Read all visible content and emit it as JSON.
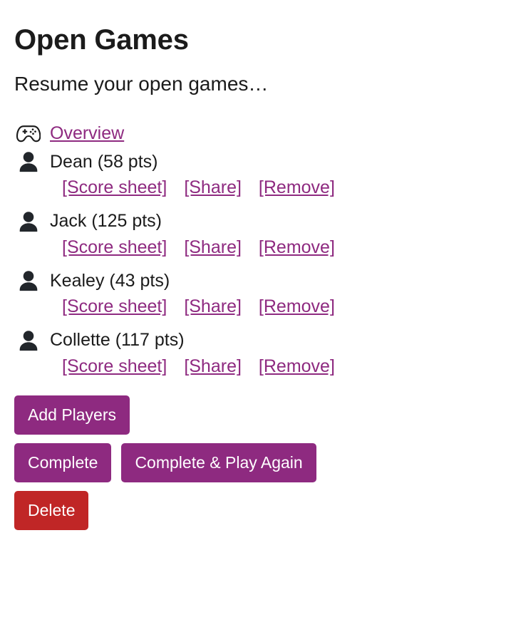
{
  "header": {
    "title": "Open Games",
    "subtitle": "Resume your open games…"
  },
  "colors": {
    "link": "#8e2a80",
    "button_primary": "#8e2a80",
    "button_danger": "#c02626",
    "text": "#1b1b1b",
    "background": "#ffffff"
  },
  "game": {
    "overview_icon": "gamepad-icon",
    "overview_label": "Overview",
    "player_icon": "person-icon",
    "actions": {
      "score_sheet": "[Score sheet]",
      "share": "[Share]",
      "remove": "[Remove]"
    },
    "players": [
      {
        "name": "Dean",
        "points": "58",
        "label": "Dean (58 pts)"
      },
      {
        "name": "Jack",
        "points": "125",
        "label": "Jack (125 pts)"
      },
      {
        "name": "Kealey",
        "points": "43",
        "label": "Kealey (43 pts)"
      },
      {
        "name": "Collette",
        "points": "117",
        "label": "Collette (117 pts)"
      }
    ]
  },
  "buttons": {
    "add_players": "Add Players",
    "complete": "Complete",
    "complete_play_again": "Complete & Play Again",
    "delete": "Delete"
  }
}
